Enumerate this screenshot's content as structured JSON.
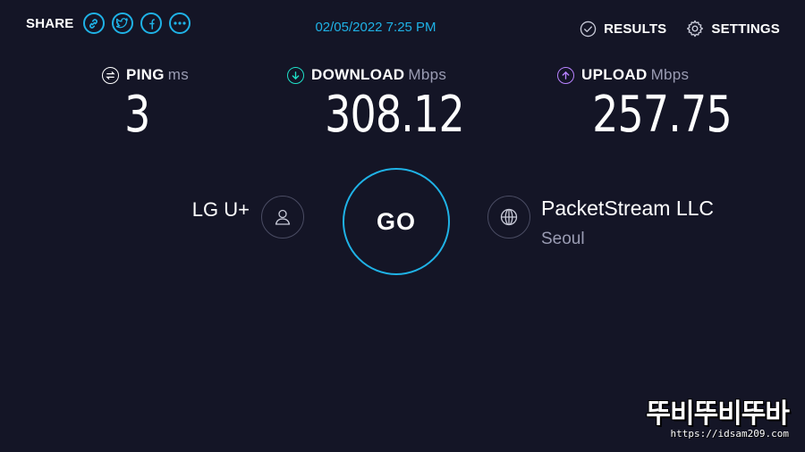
{
  "header": {
    "share_label": "SHARE",
    "share_icons": [
      "link-icon",
      "twitter-icon",
      "facebook-icon",
      "more-icon"
    ],
    "datetime": "02/05/2022 7:25 PM",
    "results_label": "RESULTS",
    "settings_label": "SETTINGS"
  },
  "metrics": {
    "ping": {
      "label": "PING",
      "unit": "ms",
      "value": "3",
      "icon": "ping-icon"
    },
    "download": {
      "label": "DOWNLOAD",
      "unit": "Mbps",
      "value": "308.12",
      "icon": "download-icon",
      "color": "#1fb2e6"
    },
    "upload": {
      "label": "UPLOAD",
      "unit": "Mbps",
      "value": "257.75",
      "icon": "upload-icon",
      "color": "#b882ff"
    }
  },
  "test": {
    "go_label": "GO",
    "isp": "LG U+",
    "server_name": "PacketStream LLC",
    "server_location": "Seoul"
  },
  "watermark": {
    "logo": "뚜비뚜비뚜바",
    "url": "https://idsam209.com"
  },
  "colors": {
    "background": "#141526",
    "accent": "#1fb2e6",
    "muted": "#9a9cb3"
  }
}
